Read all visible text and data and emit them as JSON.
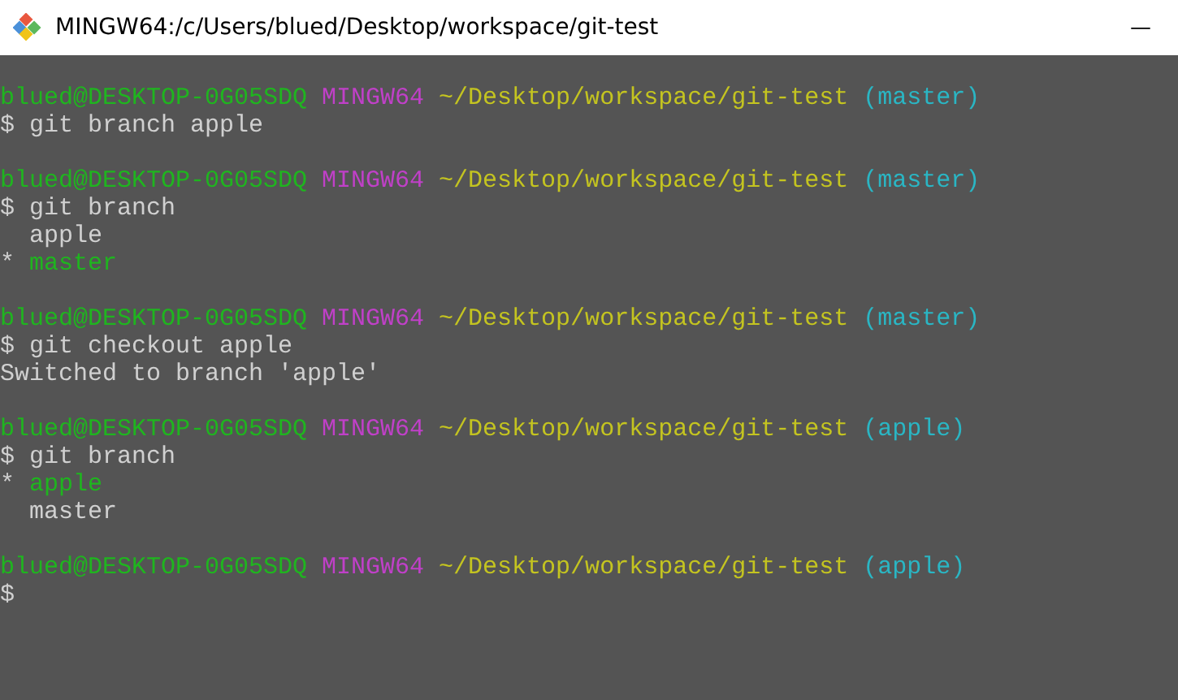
{
  "window": {
    "title": "MINGW64:/c/Users/blued/Desktop/workspace/git-test",
    "minimize": "—"
  },
  "terminal": {
    "blocks": [
      {
        "prompt": {
          "user_host": "blued@DESKTOP-0G05SDQ",
          "shell": "MINGW64",
          "path": "~/Desktop/workspace/git-test",
          "branch": "(master)"
        },
        "command": "$ git branch apple"
      },
      {
        "prompt": {
          "user_host": "blued@DESKTOP-0G05SDQ",
          "shell": "MINGW64",
          "path": "~/Desktop/workspace/git-test",
          "branch": "(master)"
        },
        "command": "$ git branch",
        "output": [
          {
            "kind": "branch",
            "name": "apple",
            "current": false
          },
          {
            "kind": "branch",
            "marker": "*",
            "name": "master",
            "current": true
          }
        ]
      },
      {
        "prompt": {
          "user_host": "blued@DESKTOP-0G05SDQ",
          "shell": "MINGW64",
          "path": "~/Desktop/workspace/git-test",
          "branch": "(master)"
        },
        "command": "$ git checkout apple",
        "output": [
          {
            "kind": "text",
            "text": "Switched to branch 'apple'"
          }
        ]
      },
      {
        "prompt": {
          "user_host": "blued@DESKTOP-0G05SDQ",
          "shell": "MINGW64",
          "path": "~/Desktop/workspace/git-test",
          "branch": "(apple)"
        },
        "command": "$ git branch",
        "output": [
          {
            "kind": "branch",
            "marker": "*",
            "name": "apple",
            "current": true
          },
          {
            "kind": "branch",
            "name": "master",
            "current": false
          }
        ]
      },
      {
        "prompt": {
          "user_host": "blued@DESKTOP-0G05SDQ",
          "shell": "MINGW64",
          "path": "~/Desktop/workspace/git-test",
          "branch": "(apple)"
        },
        "command": "$"
      }
    ]
  }
}
